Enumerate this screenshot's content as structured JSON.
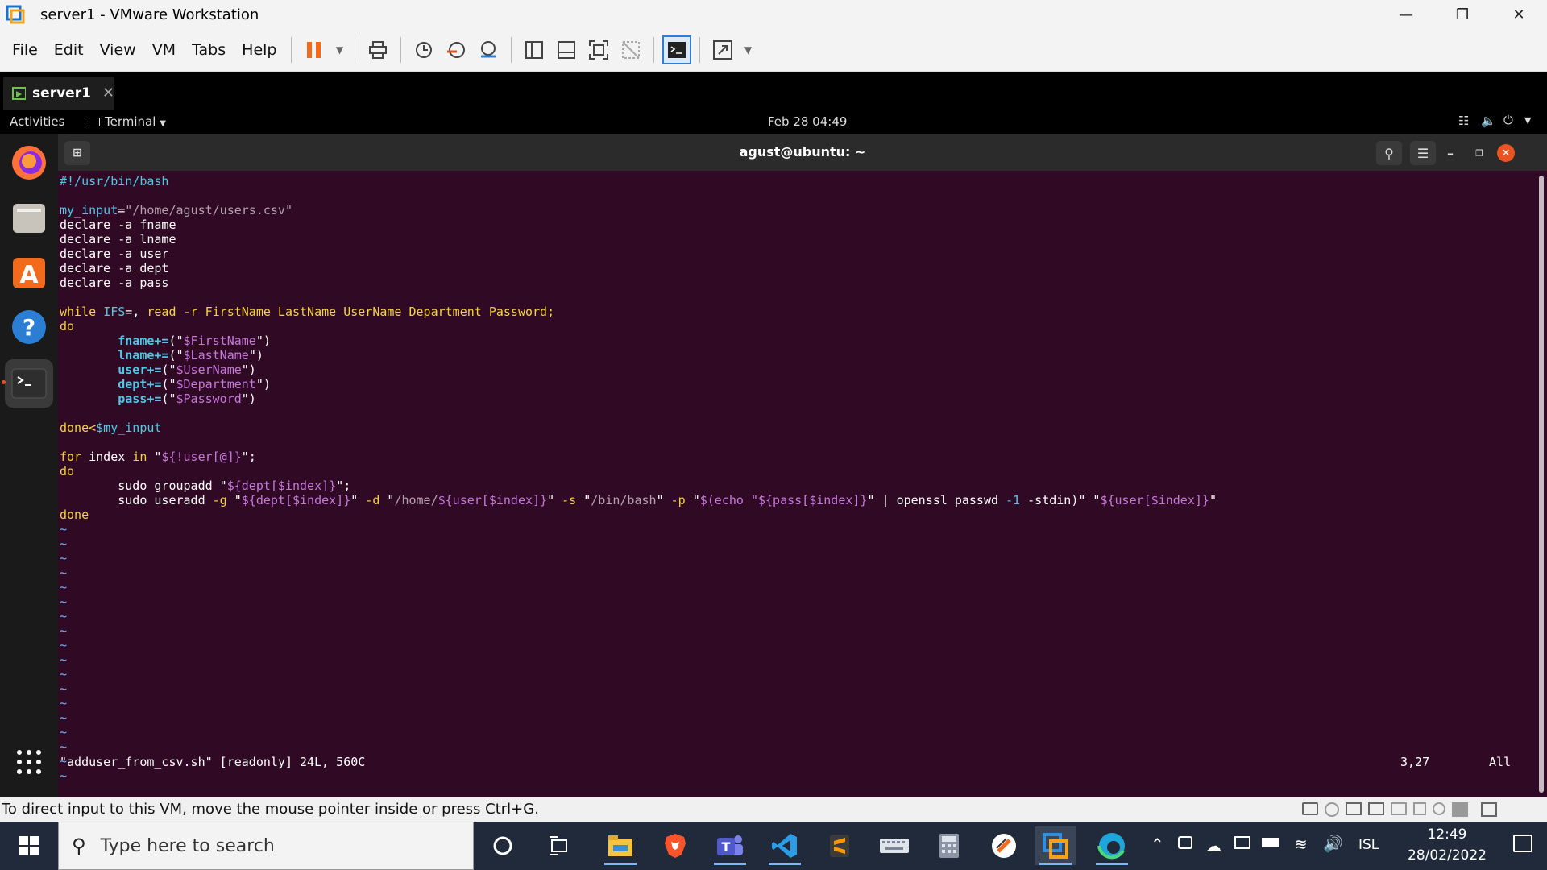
{
  "window": {
    "title": "server1 - VMware Workstation",
    "minimize_icon": "minimize-icon",
    "restore_icon": "restore-icon",
    "close_icon": "close-icon"
  },
  "menubar": {
    "items": [
      "File",
      "Edit",
      "View",
      "VM",
      "Tabs",
      "Help"
    ],
    "toolbar_icons": [
      "pause-icon",
      "dropdown-icon",
      "send-ctrl-alt-del-icon",
      "snapshot-icon",
      "revert-snapshot-icon",
      "snapshot-manager-icon",
      "show-library-icon",
      "thumbnail-bar-icon",
      "full-screen-icon",
      "unity-icon",
      "console-view-icon",
      "stretch-icon",
      "dropdown-icon"
    ]
  },
  "tabs": [
    {
      "label": "server1"
    }
  ],
  "guest": {
    "topbar": {
      "activities": "Activities",
      "app_menu": "Terminal",
      "clock": "Feb 28  04:49"
    },
    "terminal_title": "agust@ubuntu: ~",
    "dock": [
      "firefox-icon",
      "files-icon",
      "software-center-icon",
      "help-icon",
      "terminal-icon"
    ],
    "status_line": {
      "file": "\"adduser_from_csv.sh\" [readonly] 24L, 560C",
      "position": "3,27",
      "scroll": "All"
    }
  },
  "code": [
    [
      [
        "#!/usr/bin/bash",
        "c-cy"
      ]
    ],
    [],
    [
      [
        "my_input",
        "c-cy"
      ],
      [
        "=",
        "c-wh"
      ],
      [
        "\"/home/agust/users.csv\"",
        "c-gy"
      ]
    ],
    [
      [
        "declare -a fname",
        "c-wh"
      ]
    ],
    [
      [
        "declare -a lname",
        "c-wh"
      ]
    ],
    [
      [
        "declare -a user",
        "c-wh"
      ]
    ],
    [
      [
        "declare -a dept",
        "c-wh"
      ]
    ],
    [
      [
        "declare -a pass",
        "c-wh"
      ]
    ],
    [],
    [
      [
        "while",
        "c-yl"
      ],
      [
        " ",
        "c-wh"
      ],
      [
        "IFS",
        "c-cy"
      ],
      [
        "=, ",
        "c-wh"
      ],
      [
        "read -r FirstName LastName UserName Department Password;",
        "c-yl"
      ]
    ],
    [
      [
        "do",
        "c-yl"
      ]
    ],
    [
      [
        "        ",
        "c-wh"
      ],
      [
        "fname+=",
        "c-bcy"
      ],
      [
        "(\"",
        "c-wh"
      ],
      [
        "$FirstName",
        "c-mg"
      ],
      [
        "\")",
        "c-wh"
      ]
    ],
    [
      [
        "        ",
        "c-wh"
      ],
      [
        "lname+=",
        "c-bcy"
      ],
      [
        "(\"",
        "c-wh"
      ],
      [
        "$LastName",
        "c-mg"
      ],
      [
        "\")",
        "c-wh"
      ]
    ],
    [
      [
        "        ",
        "c-wh"
      ],
      [
        "user+=",
        "c-bcy"
      ],
      [
        "(\"",
        "c-wh"
      ],
      [
        "$UserName",
        "c-mg"
      ],
      [
        "\")",
        "c-wh"
      ]
    ],
    [
      [
        "        ",
        "c-wh"
      ],
      [
        "dept+=",
        "c-bcy"
      ],
      [
        "(\"",
        "c-wh"
      ],
      [
        "$Department",
        "c-mg"
      ],
      [
        "\")",
        "c-wh"
      ]
    ],
    [
      [
        "        ",
        "c-wh"
      ],
      [
        "pass+=",
        "c-bcy"
      ],
      [
        "(\"",
        "c-wh"
      ],
      [
        "$Password",
        "c-mg"
      ],
      [
        "\")",
        "c-wh"
      ]
    ],
    [],
    [
      [
        "done<",
        "c-yl"
      ],
      [
        "$my_input",
        "c-cy"
      ]
    ],
    [],
    [
      [
        "for",
        "c-yl"
      ],
      [
        " index ",
        "c-wh"
      ],
      [
        "in",
        "c-yl"
      ],
      [
        " \"",
        "c-wh"
      ],
      [
        "${!user[@]}",
        "c-mg"
      ],
      [
        "\";",
        "c-wh"
      ]
    ],
    [
      [
        "do",
        "c-yl"
      ]
    ],
    [
      [
        "        sudo groupadd \"",
        "c-wh"
      ],
      [
        "${dept[$index]}",
        "c-mg"
      ],
      [
        "\";",
        "c-wh"
      ]
    ],
    [
      [
        "        sudo useradd ",
        "c-wh"
      ],
      [
        "-g",
        "c-yl"
      ],
      [
        " \"",
        "c-wh"
      ],
      [
        "${dept[$index]}",
        "c-mg"
      ],
      [
        "\" ",
        "c-wh"
      ],
      [
        "-d",
        "c-yl"
      ],
      [
        " \"",
        "c-wh"
      ],
      [
        "/home/",
        "c-gy"
      ],
      [
        "${user[$index]}",
        "c-mg"
      ],
      [
        "\" ",
        "c-wh"
      ],
      [
        "-s",
        "c-yl"
      ],
      [
        " \"",
        "c-wh"
      ],
      [
        "/bin/bash",
        "c-gy"
      ],
      [
        "\" ",
        "c-wh"
      ],
      [
        "-p",
        "c-yl"
      ],
      [
        " \"",
        "c-wh"
      ],
      [
        "$(echo \"",
        "c-mg"
      ],
      [
        "${pass[$index]}",
        "c-mg"
      ],
      [
        "\" | openssl passwd ",
        "c-wh"
      ],
      [
        "-1",
        "c-cy"
      ],
      [
        " -stdin)\"",
        "c-wh"
      ],
      [
        " \"",
        "c-wh"
      ],
      [
        "${user[$index]}",
        "c-mg"
      ],
      [
        "\"",
        "c-wh"
      ]
    ],
    [
      [
        "done",
        "c-yl"
      ]
    ]
  ],
  "tilde_count": 18,
  "vmstatus": {
    "message": "To direct input to this VM, move the mouse pointer inside or press Ctrl+G."
  },
  "taskbar": {
    "search_placeholder": "Type here to search",
    "apps": [
      "cortana-icon",
      "task-view-icon",
      "file-explorer-icon",
      "brave-icon",
      "teams-icon",
      "vscode-icon",
      "sublime-text-icon",
      "keyboard-icon",
      "calculator-icon",
      "app-icon",
      "vmware-icon",
      "edge-icon"
    ],
    "language": "ISL",
    "time": "12:49",
    "date": "28/02/2022"
  },
  "colors": {
    "terminal_bg": "#300a24",
    "taskbar_bg": "#202a3a",
    "dock_bg": "#1a1a1a"
  }
}
